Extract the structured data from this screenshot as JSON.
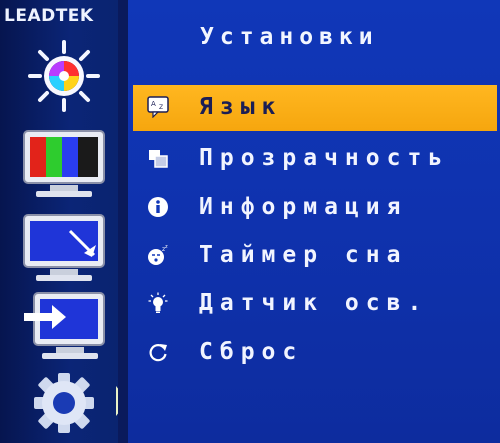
{
  "brand": {
    "logo": "LEADTEK"
  },
  "title": "Установки",
  "sidebar": [
    {
      "name": "brightness-icon"
    },
    {
      "name": "color-bars-icon"
    },
    {
      "name": "resize-screen-icon"
    },
    {
      "name": "input-screen-icon"
    },
    {
      "name": "settings-gear-icon",
      "active": true
    }
  ],
  "menu": {
    "items": [
      {
        "label": "Язык",
        "icon": "language-icon",
        "selected": true
      },
      {
        "label": "Прозрачность",
        "icon": "transparency-icon"
      },
      {
        "label": "Информация",
        "icon": "info-icon"
      },
      {
        "label": "Таймер сна",
        "icon": "sleep-timer-icon"
      },
      {
        "label": "Датчик осв.",
        "icon": "light-sensor-icon"
      },
      {
        "label": "Сброс",
        "icon": "reset-icon"
      }
    ]
  },
  "colors": {
    "selection": "#ffb720",
    "background": "#0f32ae",
    "sidebar": "#0b2577"
  }
}
